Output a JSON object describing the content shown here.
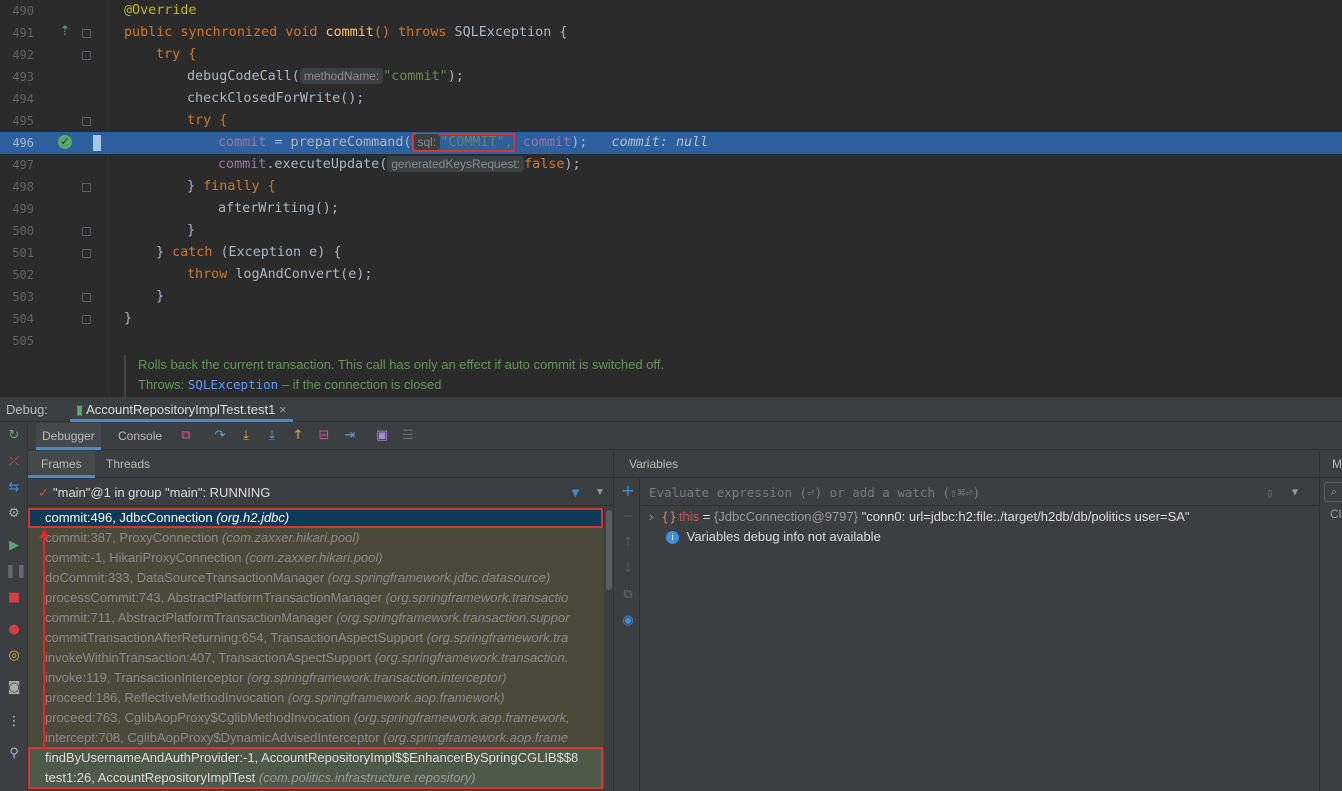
{
  "editor": {
    "lines": [
      {
        "num": "490"
      },
      {
        "num": "491"
      },
      {
        "num": "492"
      },
      {
        "num": "493"
      },
      {
        "num": "494"
      },
      {
        "num": "495"
      },
      {
        "num": "496"
      },
      {
        "num": "497"
      },
      {
        "num": "498"
      },
      {
        "num": "499"
      },
      {
        "num": "500"
      },
      {
        "num": "501"
      },
      {
        "num": "502"
      },
      {
        "num": "503"
      },
      {
        "num": "504"
      },
      {
        "num": "505"
      }
    ],
    "code": {
      "l490_ann": "@Override",
      "l491_mods": "public synchronized void ",
      "l491_name": "commit",
      "l491_throws": "() throws ",
      "l491_rest": "SQLException {",
      "l492_try": "try {",
      "l493_call": "debugCodeCall(",
      "l493_hint": "methodName:",
      "l493_str": "\"commit\"",
      "l493_end": ");",
      "l494_call": "checkClosedForWrite();",
      "l495_try": "try {",
      "l496_field": "commit",
      "l496_eq": " = prepareCommand(",
      "l496_hint": "sql:",
      "l496_str": "\"COMMIT\",",
      "l496_arg": "commit",
      "l496_end": ");",
      "l496_inline": "commit: null",
      "l497_field": "commit",
      "l497_call": ".executeUpdate(",
      "l497_hint": "generatedKeysRequest:",
      "l497_val": "false",
      "l497_end": ");",
      "l498_close": "} ",
      "l498_finally": "finally {",
      "l499_call": "afterWriting();",
      "l500_close": "}",
      "l501_close": "} ",
      "l501_catch": "catch",
      "l501_rest": " (Exception e) {",
      "l502_throw": "throw ",
      "l502_rest": "logAndConvert(e);",
      "l503_close": "}",
      "l504_close": "}"
    },
    "doc": {
      "line1": "Rolls back the current transaction. This call has only an effect if auto commit is switched off.",
      "throws_label": "Throws:",
      "throws_link": "SQLException",
      "throws_rest": " – if the connection is closed"
    }
  },
  "debug": {
    "label": "Debug:",
    "session_tab": "AccountRepositoryImplTest.test1",
    "tabs": {
      "debugger": "Debugger",
      "console": "Console"
    },
    "frames_tab": "Frames",
    "threads_tab": "Threads",
    "thread": "\"main\"@1 in group \"main\": RUNNING",
    "frames": [
      {
        "method": "commit:496, JdbcConnection ",
        "pkg": "(org.h2.jdbc)"
      },
      {
        "method": "commit:387, ProxyConnection ",
        "pkg": "(com.zaxxer.hikari.pool)"
      },
      {
        "method": "commit:-1, HikariProxyConnection ",
        "pkg": "(com.zaxxer.hikari.pool)"
      },
      {
        "method": "doCommit:333, DataSourceTransactionManager ",
        "pkg": "(org.springframework.jdbc.datasource)"
      },
      {
        "method": "processCommit:743, AbstractPlatformTransactionManager ",
        "pkg": "(org.springframework.transactio"
      },
      {
        "method": "commit:711, AbstractPlatformTransactionManager ",
        "pkg": "(org.springframework.transaction.suppor"
      },
      {
        "method": "commitTransactionAfterReturning:654, TransactionAspectSupport ",
        "pkg": "(org.springframework.tra"
      },
      {
        "method": "invokeWithinTransaction:407, TransactionAspectSupport ",
        "pkg": "(org.springframework.transaction."
      },
      {
        "method": "invoke:119, TransactionInterceptor ",
        "pkg": "(org.springframework.transaction.interceptor)"
      },
      {
        "method": "proceed:186, ReflectiveMethodInvocation ",
        "pkg": "(org.springframework.aop.framework)"
      },
      {
        "method": "proceed:763, CglibAopProxy$CglibMethodInvocation ",
        "pkg": "(org.springframework.aop.framework,"
      },
      {
        "method": "intercept:708, CglibAopProxy$DynamicAdvisedInterceptor ",
        "pkg": "(org.springframework.aop.frame"
      },
      {
        "method": "findByUsernameAndAuthProvider:-1, AccountRepositoryImpl$$EnhancerBySpringCGLIB$$8",
        "pkg": ""
      },
      {
        "method": "test1:26, AccountRepositoryImplTest ",
        "pkg": "(com.politics.infrastructure.repository)"
      }
    ],
    "variables_title": "Variables",
    "eval_placeholder": "Evaluate expression (⏎) or add a watch (⇧⌘⏎)",
    "vars": {
      "this_name": "this",
      "this_eq": " = ",
      "this_type": "{JdbcConnection@9797}",
      "this_value": " \"conn0: url=jdbc:h2:file:./target/h2db/db/politics user=SA\"",
      "info": "Variables debug info not available"
    },
    "right_edge": {
      "tab": "M",
      "label": "Cla"
    }
  }
}
